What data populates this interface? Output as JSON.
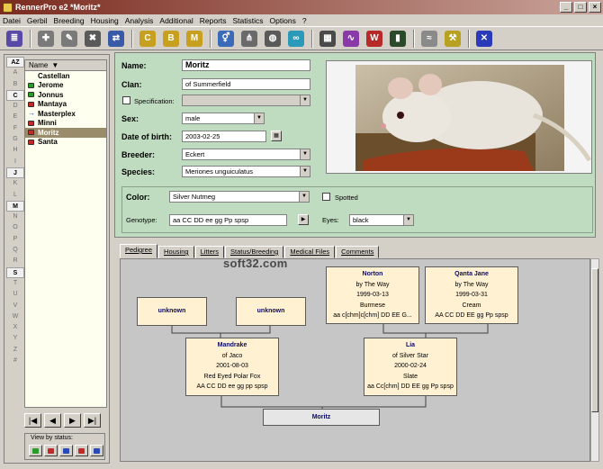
{
  "window": {
    "title": "RennerPro e2 *Moritz*",
    "buttons": [
      "_",
      "□",
      "×"
    ]
  },
  "menu": [
    "Datei",
    "Gerbil",
    "Breeding",
    "Housing",
    "Analysis",
    "Additional",
    "Reports",
    "Statistics",
    "Options",
    "?"
  ],
  "toolbar": {
    "icons": [
      {
        "name": "list-icon",
        "glyph": "≣",
        "color": "#5a4aa8"
      },
      {
        "name": "gerbil-add-icon",
        "glyph": "✚",
        "color": "#7a7a7a"
      },
      {
        "name": "gerbil-edit-icon",
        "glyph": "✎",
        "color": "#7a7a7a"
      },
      {
        "name": "gerbil-delete-icon",
        "glyph": "✖",
        "color": "#5a5a5a"
      },
      {
        "name": "gerbil-move-icon",
        "glyph": "⇄",
        "color": "#3a5aa8"
      },
      {
        "name": "filter-c-icon",
        "glyph": "C",
        "color": "#c8a020"
      },
      {
        "name": "filter-b-icon",
        "glyph": "B",
        "color": "#c8a020"
      },
      {
        "name": "filter-m-icon",
        "glyph": "M",
        "color": "#c8a020"
      },
      {
        "name": "gender-icon",
        "glyph": "⚥",
        "color": "#3a6ab8"
      },
      {
        "name": "family-tree-icon",
        "glyph": "⋔",
        "color": "#6a6a6a"
      },
      {
        "name": "globe-icon",
        "glyph": "◍",
        "color": "#5a5a5a"
      },
      {
        "name": "gene-icon",
        "glyph": "∞",
        "color": "#2a9ab8"
      },
      {
        "name": "calculator-icon",
        "glyph": "▦",
        "color": "#4a4a4a"
      },
      {
        "name": "chart-icon",
        "glyph": "∿",
        "color": "#8a3aa8"
      },
      {
        "name": "report-w-icon",
        "glyph": "W",
        "color": "#b82a2a"
      },
      {
        "name": "book-icon",
        "glyph": "▮",
        "color": "#2a4a2a"
      },
      {
        "name": "feather-icon",
        "glyph": "≈",
        "color": "#8a8a8a"
      },
      {
        "name": "tools-icon",
        "glyph": "⚒",
        "color": "#b8a020"
      },
      {
        "name": "exit-icon",
        "glyph": "✕",
        "color": "#2a3ab8"
      }
    ]
  },
  "sidebar": {
    "sort_label": "AZ",
    "alphabet": [
      "A",
      "B",
      "C",
      "D",
      "E",
      "F",
      "G",
      "H",
      "I",
      "J",
      "K",
      "L",
      "M",
      "N",
      "O",
      "P",
      "Q",
      "R",
      "S",
      "T",
      "U",
      "V",
      "W",
      "X",
      "Y",
      "Z",
      "#"
    ],
    "active_letters": [
      "C",
      "J",
      "M",
      "S"
    ],
    "list_header": "Name",
    "animals": [
      {
        "name": "Castellan",
        "status": "none"
      },
      {
        "name": "Jerome",
        "status": "green"
      },
      {
        "name": "Jonnus",
        "status": "green"
      },
      {
        "name": "Mantaya",
        "status": "red"
      },
      {
        "name": "Masterplex",
        "status": "blue"
      },
      {
        "name": "Minni",
        "status": "red"
      },
      {
        "name": "Moritz",
        "status": "red",
        "selected": true
      },
      {
        "name": "Santa",
        "status": "red"
      }
    ],
    "nav": [
      "|◀",
      "◀",
      "▶",
      "▶|"
    ],
    "view_by_status_label": "View by status:",
    "status_colors": [
      "#2a9a2a",
      "#c02a2a",
      "#2a4ab8",
      "#c02a2a",
      "#2a4ab8"
    ]
  },
  "details": {
    "name_label": "Name:",
    "name": "Moritz",
    "clan_label": "Clan:",
    "clan": "of Summerfield",
    "specification_label": "Specification:",
    "sex_label": "Sex:",
    "sex": "male",
    "dob_label": "Date of birth:",
    "dob": "2003-02-25",
    "breeder_label": "Breeder:",
    "breeder": "Eckert",
    "species_label": "Species:",
    "species": "Meriones unguiculatus",
    "color_label": "Color:",
    "color": "Silver Nutmeg",
    "spotted_label": "Spotted",
    "genotype_label": "Genotype:",
    "genotype": "aa CC DD ee gg Pp spsp",
    "eyes_label": "Eyes:",
    "eyes": "black"
  },
  "tabs": [
    "Pedigree",
    "Housing",
    "Litters",
    "Status/Breeding",
    "Medical Files",
    "Comments"
  ],
  "watermark": "soft32.com",
  "pedigree": {
    "unknown1": {
      "name": "unknown"
    },
    "unknown2": {
      "name": "unknown"
    },
    "norton": {
      "name": "Norton",
      "clan": "by The Way",
      "dob": "1999-03-13",
      "color": "Burmese",
      "genotype": "aa c[chm]c[chm] DD EE G..."
    },
    "qanta": {
      "name": "Qanta Jane",
      "clan": "by The Way",
      "dob": "1999-03-31",
      "color": "Cream",
      "genotype": "AA CC DD EE gg Pp spsp"
    },
    "mandrake": {
      "name": "Mandrake",
      "clan": "of Jaco",
      "dob": "2001-08-03",
      "color": "Red Eyed Polar Fox",
      "genotype": "AA CC DD ee gg pp spsp"
    },
    "lia": {
      "name": "Lia",
      "clan": "of Silver Star",
      "dob": "2000-02-24",
      "color": "Slate",
      "genotype": "aa Cc[chm] DD EE gg Pp spsp"
    },
    "self": {
      "name": "Moritz"
    }
  }
}
